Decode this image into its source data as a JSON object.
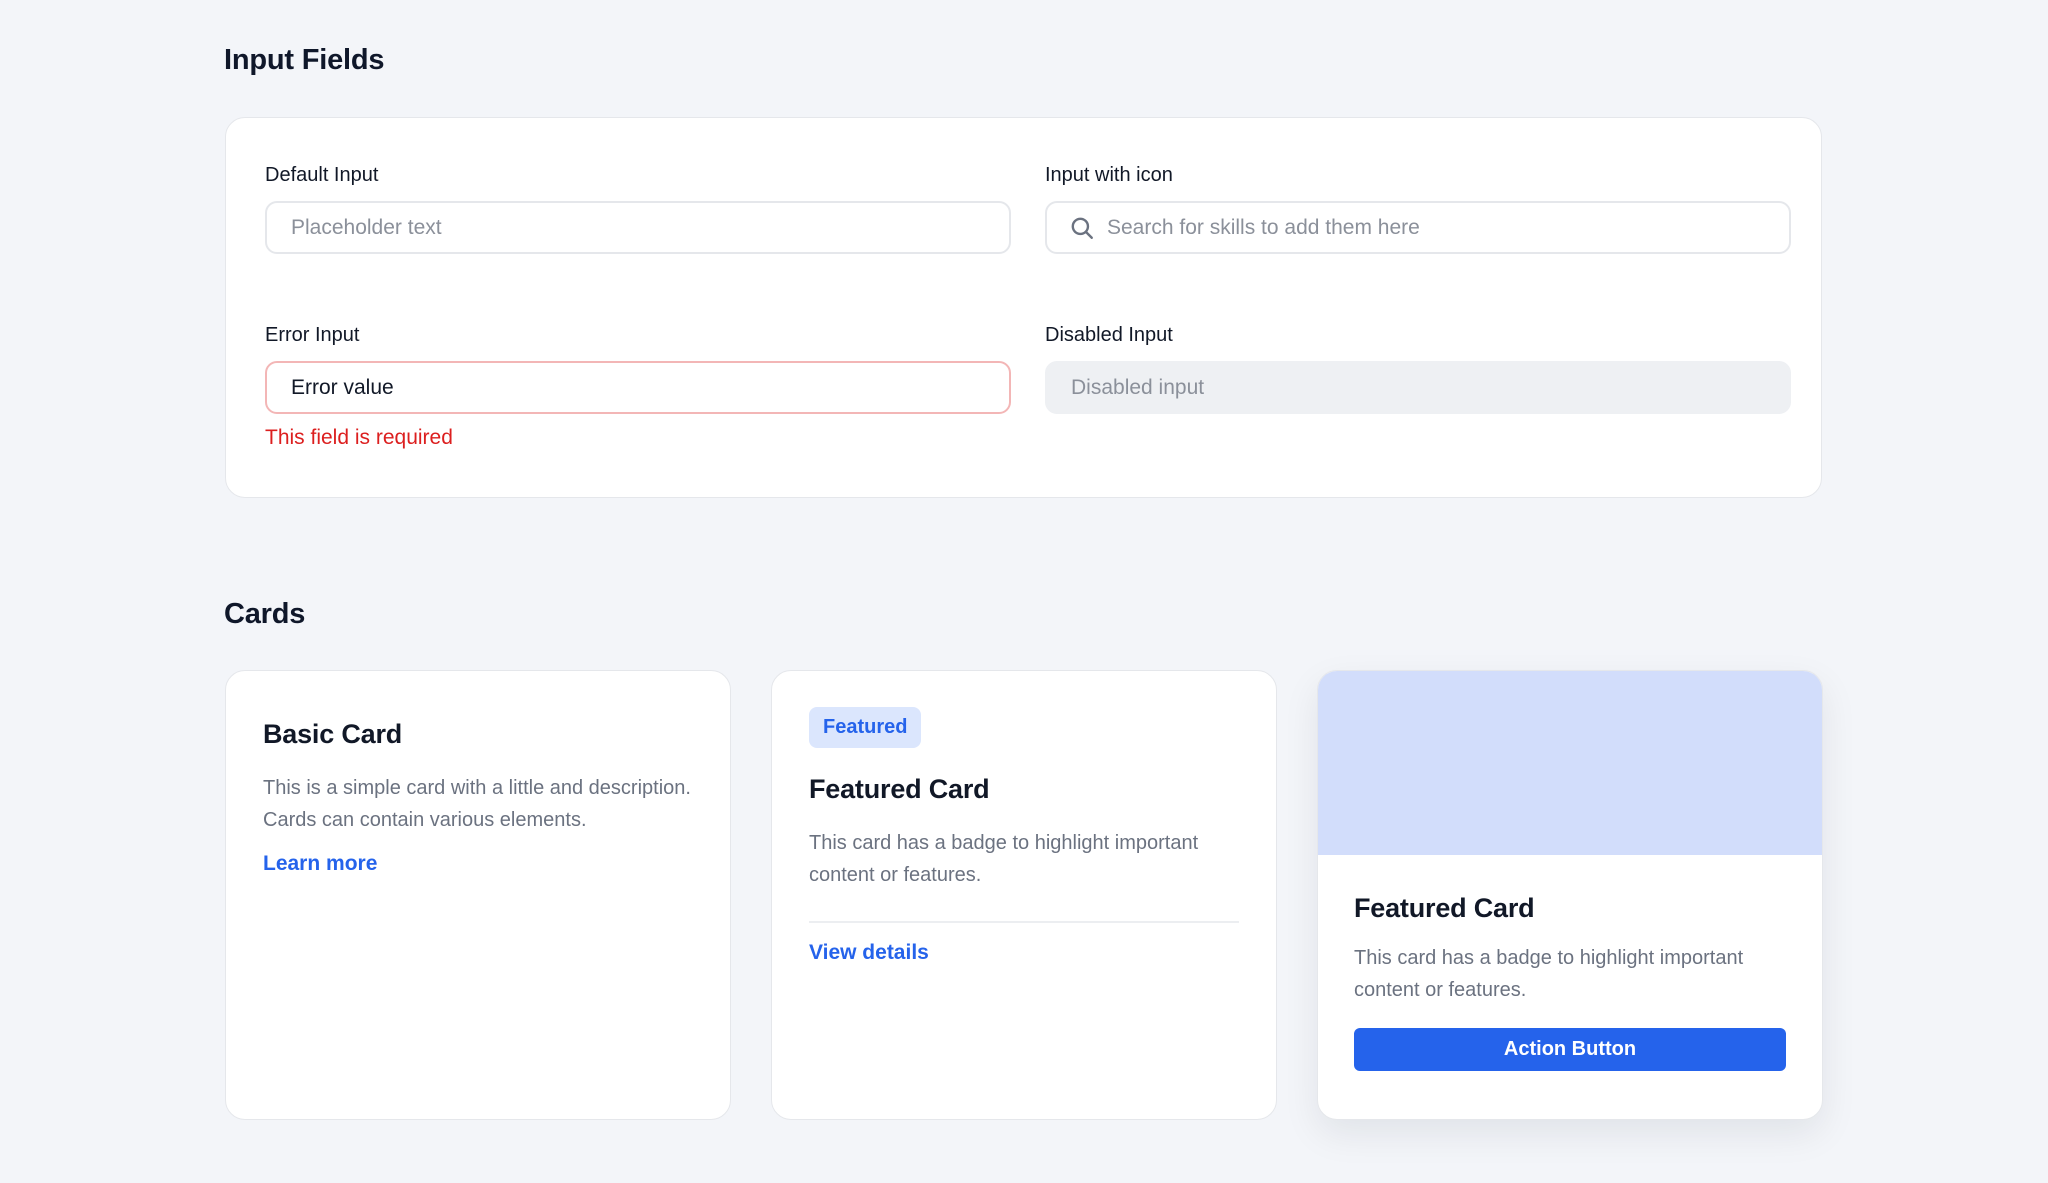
{
  "sections": {
    "inputs_title": "Input Fields",
    "cards_title": "Cards"
  },
  "inputs": {
    "default": {
      "label": "Default Input",
      "placeholder": "Placeholder text",
      "value": ""
    },
    "with_icon": {
      "label": "Input with icon",
      "placeholder": "Search for skills to add them here",
      "value": "",
      "icon": "search-icon"
    },
    "error": {
      "label": "Error Input",
      "value": "Error value",
      "error_message": "This field is required"
    },
    "disabled": {
      "label": "Disabled Input",
      "placeholder": "Disabled input",
      "value": ""
    }
  },
  "cards": {
    "basic": {
      "title": "Basic Card",
      "description": "This is a simple card with a little and description. Cards can contain various elements.",
      "link_label": "Learn more"
    },
    "featured": {
      "badge": "Featured",
      "title": "Featured Card",
      "description": "This card has a badge to highlight important content or features.",
      "link_label": "View details"
    },
    "media": {
      "title": "Featured Card",
      "description": "This card has a badge to highlight important content or features.",
      "button_label": "Action Button"
    }
  },
  "colors": {
    "page_background": "#f3f5f9",
    "accent": "#2563eb",
    "error": "#dc1f1f",
    "badge_background": "#dbe6fd",
    "media_placeholder": "#d2ddfb"
  }
}
